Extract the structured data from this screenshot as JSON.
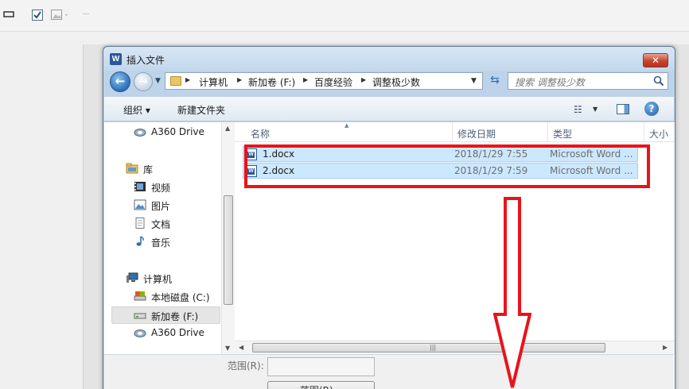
{
  "dialog": {
    "title": "插入文件",
    "close_glyph": "✕"
  },
  "address_bar": {
    "crumbs": [
      "计算机",
      "新加卷 (F:)",
      "百度经验",
      "调整极少数"
    ]
  },
  "search": {
    "placeholder": "搜索 调整极少数"
  },
  "toolbar": {
    "organize_label": "组织 ▾",
    "new_folder_label": "新建文件夹",
    "help_glyph": "?"
  },
  "nav_pane": {
    "items": [
      {
        "label": "A360 Drive",
        "icon": "cloud-drive-icon"
      },
      {
        "label": "库",
        "icon": "library-icon"
      },
      {
        "label": "视频",
        "icon": "video-library-icon"
      },
      {
        "label": "图片",
        "icon": "picture-library-icon"
      },
      {
        "label": "文档",
        "icon": "documents-library-icon"
      },
      {
        "label": "音乐",
        "icon": "music-library-icon"
      },
      {
        "label": "计算机",
        "icon": "computer-icon"
      },
      {
        "label": "本地磁盘 (C:)",
        "icon": "local-disk-icon"
      },
      {
        "label": "新加卷 (F:)",
        "icon": "volume-drive-icon",
        "selected": true
      },
      {
        "label": "A360 Drive",
        "icon": "cloud-drive-icon"
      }
    ]
  },
  "file_list": {
    "columns": [
      "名称",
      "修改日期",
      "类型",
      "大小"
    ],
    "rows": [
      {
        "name": "1.docx",
        "modified": "2018/1/29 7:55",
        "type": "Microsoft Word ...",
        "icon": "word-document-icon"
      },
      {
        "name": "2.docx",
        "modified": "2018/1/29 7:59",
        "type": "Microsoft Word ...",
        "icon": "word-document-icon"
      }
    ]
  },
  "range": {
    "label": "范围(R):",
    "button_label": "范围(R)..."
  },
  "colors": {
    "annotation_red": "#e8141a",
    "selection_fill": "#cce8ff",
    "selection_border": "#99d1ff"
  }
}
